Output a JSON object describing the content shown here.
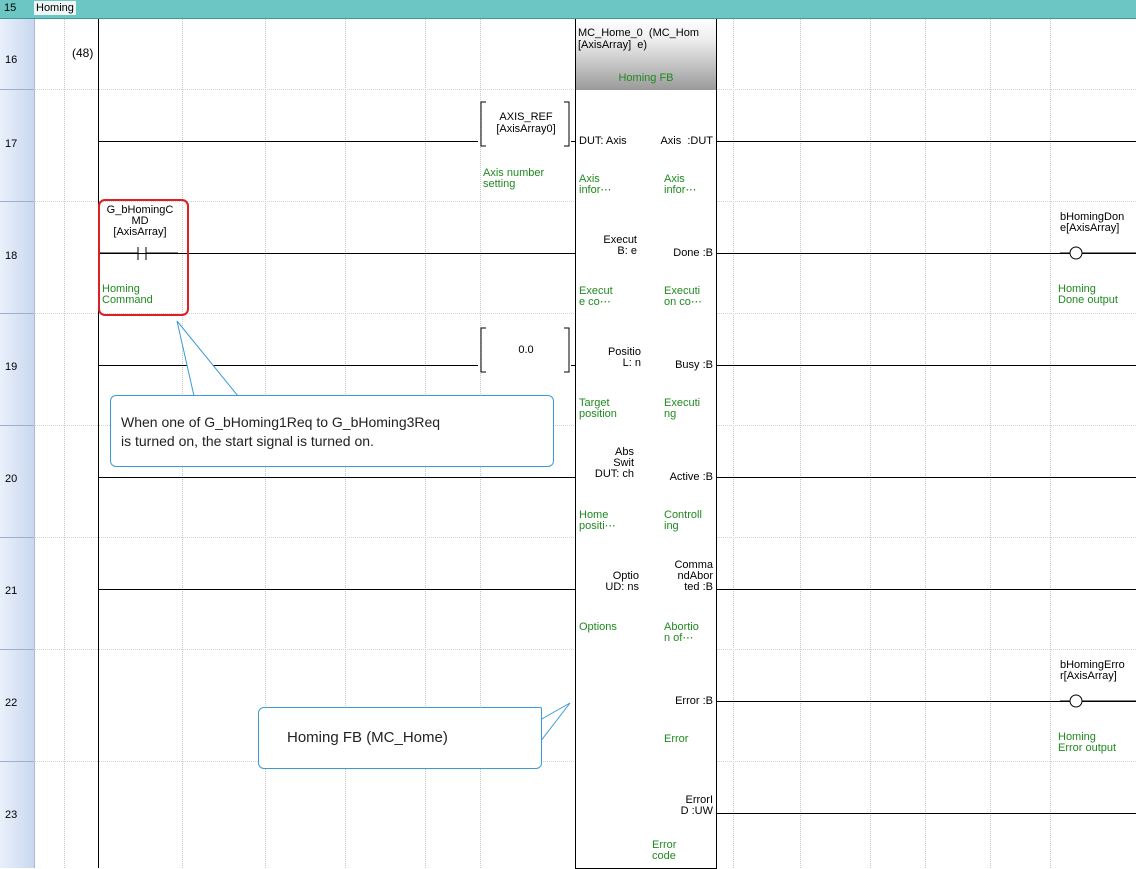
{
  "header": {
    "row_number": "15",
    "title": "Homing"
  },
  "rows": [
    "16",
    "17",
    "18",
    "19",
    "20",
    "21",
    "22",
    "23"
  ],
  "step_number": "(48)",
  "fb": {
    "instance_line1": "MC_Home_0  (MC_Hom",
    "instance_line2": "[AxisArray]  e)",
    "type_label": "Homing FB",
    "pins": {
      "axis_in": "DUT: Axis",
      "axis_out": "Axis  :DUT",
      "axis_in_comment": "Axis\ninfor⋯",
      "axis_out_comment": "Axis\ninfor⋯",
      "execute_in": "Execut\nB: e",
      "done_out": "Done :B",
      "execute_comment": "Execut\ne co⋯",
      "done_comment": "Executi\non co⋯",
      "position_in": "Positio\nL: n",
      "busy_out": "Busy :B",
      "position_comment": "Target\nposition",
      "busy_comment": "Executi\nng",
      "absswitch_in": "Abs\nSwit\nDUT: ch",
      "active_out": "Active :B",
      "absswitch_comment": "Home\npositi⋯",
      "active_comment": "Controll\ning",
      "options_in": "Optio\nUD: ns",
      "cmdabort_out": "Comma\nndAbor\nted :B",
      "options_comment": "Options",
      "cmdabort_comment": "Abortio\nn of⋯",
      "error_out": "Error :B",
      "error_comment": "Error",
      "errorid_out": "ErrorI\nD :UW",
      "errorid_comment": "Error\ncode"
    }
  },
  "axis_const": {
    "line1": "AXIS_REF",
    "line2": "[AxisArray0]",
    "comment": "Axis number\nsetting"
  },
  "position_const": {
    "value": "0.0"
  },
  "contact": {
    "label": "G_bHomingC\nMD\n[AxisArray]",
    "comment": "Homing\nCommand"
  },
  "coil_done": {
    "label": "bHomingDon\ne[AxisArray]",
    "comment": "Homing\nDone output"
  },
  "coil_error": {
    "label": "bHomingErro\nr[AxisArray]",
    "comment": "Homing\nError output"
  },
  "callouts": {
    "start_signal": "When one of G_bHoming1Req to G_bHoming3Req\nis turned on, the start signal is turned on.",
    "homing_fb": "Homing FB (MC_Home)"
  },
  "colors": {
    "header": "#6cc7c4",
    "comment_green": "#1f8a1f",
    "callout_border": "#3c9bd6",
    "highlight_red": "#e02020"
  }
}
